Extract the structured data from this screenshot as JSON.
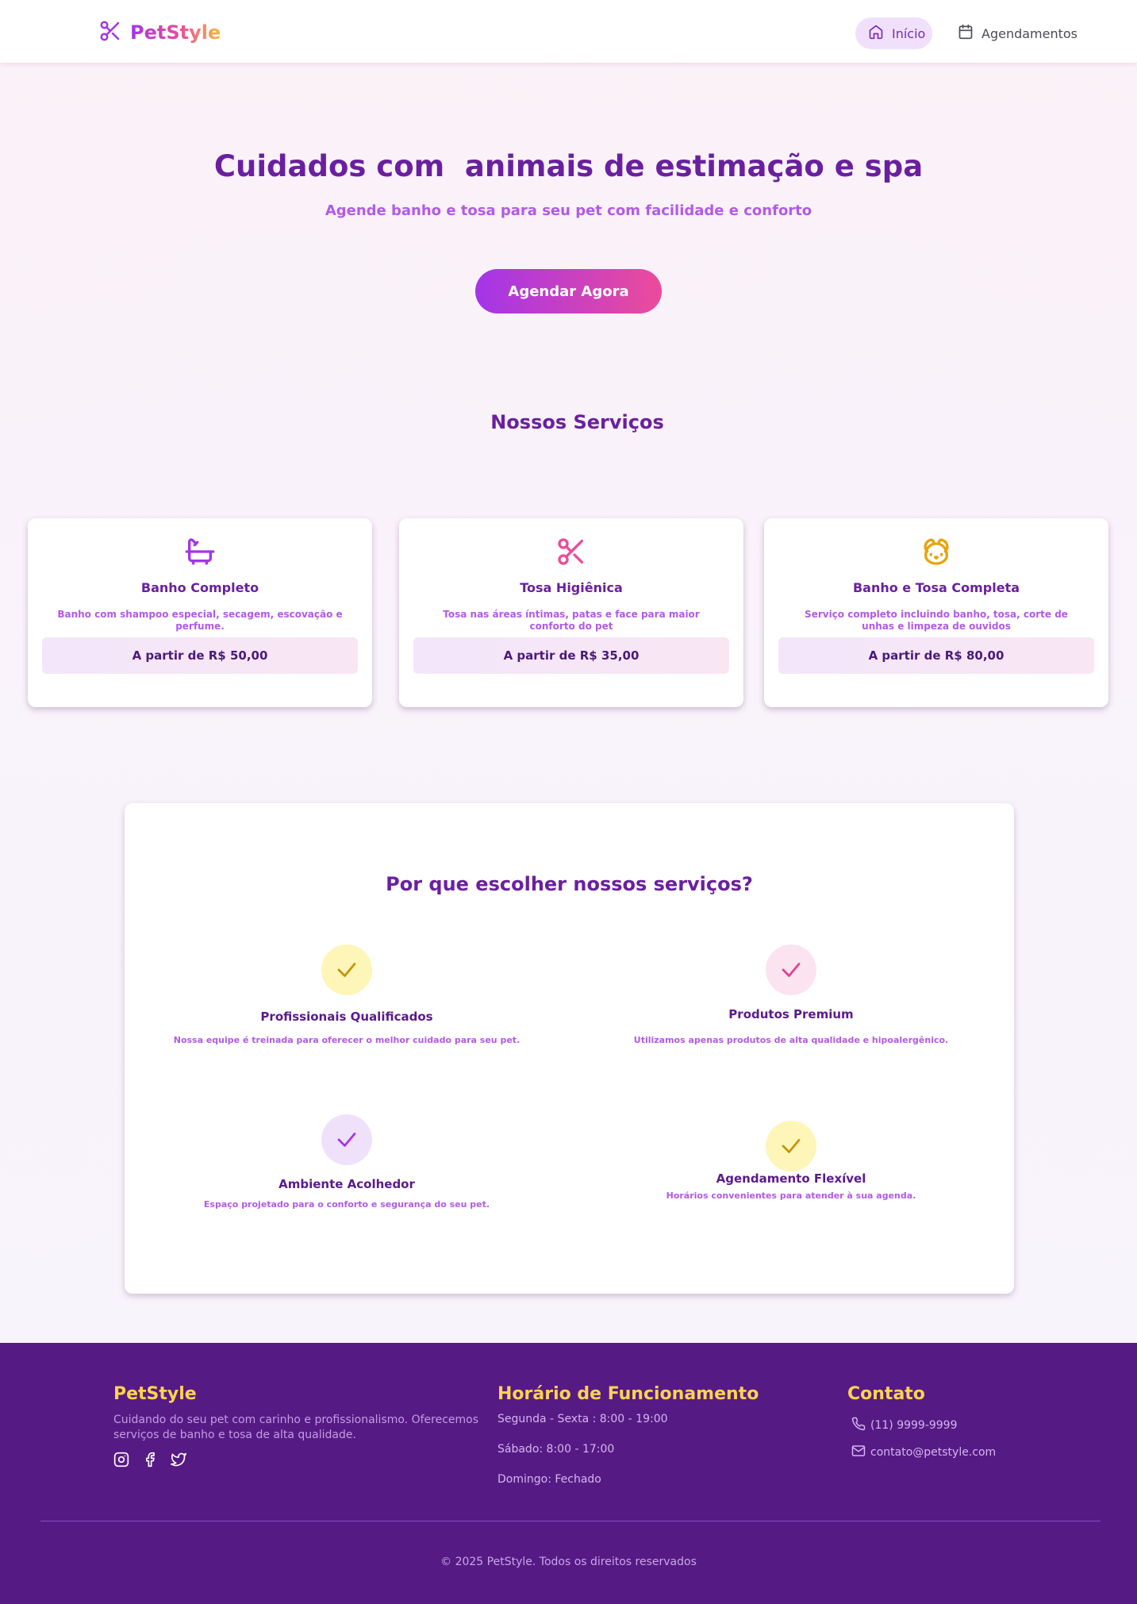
{
  "nav": {
    "brand": "PetStyle",
    "home_label": "Início",
    "schedule_label": "Agendamentos"
  },
  "hero": {
    "title": "Cuidados com  animais de estimação e spa",
    "subtitle": "Agende banho e tosa para seu pet com facilidade e conforto",
    "cta_label": "Agendar Agora"
  },
  "services": {
    "title": "Nossos Serviços",
    "items": [
      {
        "icon": "bathtub-icon",
        "title": "Banho Completo",
        "desc": "Banho com shampoo especial, secagem, escovação e perfume.",
        "price": "A partir de R$ 50,00"
      },
      {
        "icon": "scissors-icon",
        "title": "Tosa Higiênica",
        "desc": "Tosa nas áreas íntimas, patas e face para maior conforto do pet",
        "price": "A partir de R$ 35,00"
      },
      {
        "icon": "dog-icon",
        "title": "Banho e Tosa Completa",
        "desc": "Serviço completo incluindo banho, tosa, corte de unhas e limpeza de ouvidos",
        "price": "A partir de R$ 80,00"
      }
    ]
  },
  "why": {
    "title": "Por que escolher nossos serviços?",
    "features": [
      {
        "title": "Profissionais Qualificados",
        "desc": "Nossa equipe é treinada para oferecer o melhor cuidado  para seu pet."
      },
      {
        "title": "Produtos Premium",
        "desc": "Utilizamos apenas produtos de alta qualidade e hipoalergênico."
      },
      {
        "title": "Ambiente Acolhedor",
        "desc": "Espaço projetado para o conforto e segurança do seu pet."
      },
      {
        "title": "Agendamento Flexível",
        "desc": "Horários convenientes para atender à sua agenda."
      }
    ]
  },
  "footer": {
    "brand": "PetStyle",
    "about": "Cuidando do seu pet com carinho e profissionalismo. Oferecemos serviços de banho e tosa de alta qualidade.",
    "hours_title": "Horário de Funcionamento",
    "hours": [
      "Segunda - Sexta : 8:00 - 19:00",
      "Sábado:  8:00 - 17:00",
      "Domingo: Fechado"
    ],
    "contact_title": "Contato",
    "phone": "(11)  9999-9999",
    "email": "contato@petstyle.com",
    "copyright": "© 2025 PetStyle. Todos os direitos reservados"
  },
  "colors": {
    "primary": "#6a1fa0",
    "accent_purple": "#a335e8",
    "accent_pink": "#ec4b9b",
    "accent_yellow": "#f6b93b",
    "footer_bg": "#561a85",
    "footer_heading": "#fcd34d"
  }
}
